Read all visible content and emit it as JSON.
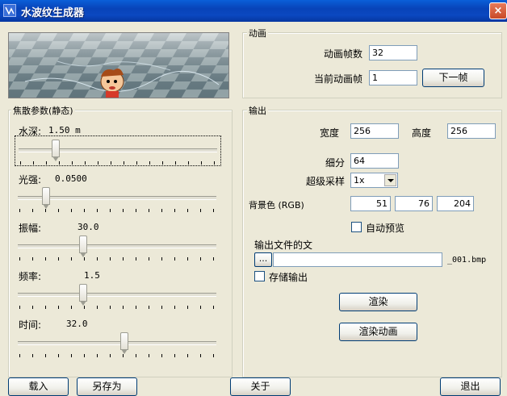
{
  "window": {
    "title": "水波纹生成器",
    "close_glyph": "×"
  },
  "preview": {
    "description_icon": "checkerboard-water-preview"
  },
  "animation": {
    "legend": "动画",
    "frame_count_label": "动画帧数",
    "frame_count_value": "32",
    "current_frame_label": "当前动画帧",
    "current_frame_value": "1",
    "next_frame_button": "下一帧"
  },
  "caustics": {
    "legend": "焦散参数(静态)",
    "depth_label": "水深:",
    "depth_value": "1.50 m",
    "depth_fraction": 0.17,
    "light_label": "光强:",
    "light_value": "0.0500",
    "light_fraction": 0.12,
    "amplitude_label": "振幅:",
    "amplitude_value": "30.0",
    "amplitude_fraction": 0.32,
    "frequency_label": "频率:",
    "frequency_value": "1.5",
    "frequency_fraction": 0.32,
    "time_label": "时间:",
    "time_value": "32.0",
    "time_fraction": 0.54
  },
  "output": {
    "legend": "输出",
    "width_label": "宽度",
    "width_value": "256",
    "height_label": "高度",
    "height_value": "256",
    "subdivide_label": "细分",
    "subdivide_value": "64",
    "supersample_label": "超级采样",
    "supersample_value": "1x",
    "bg_label": "背景色 (RGB)",
    "bg_r": "51",
    "bg_g": "76",
    "bg_b": "204",
    "auto_preview_label": "自动预览",
    "output_file_label": "输出文件的文",
    "browse_button": "...",
    "file_suffix": "_001.bmp",
    "save_output_label": "存储输出",
    "render_button": "渲染",
    "render_anim_button": "渲染动画"
  },
  "bottom": {
    "load_button": "载入",
    "save_as_button": "另存为",
    "about_button": "关于",
    "exit_button": "退出"
  }
}
